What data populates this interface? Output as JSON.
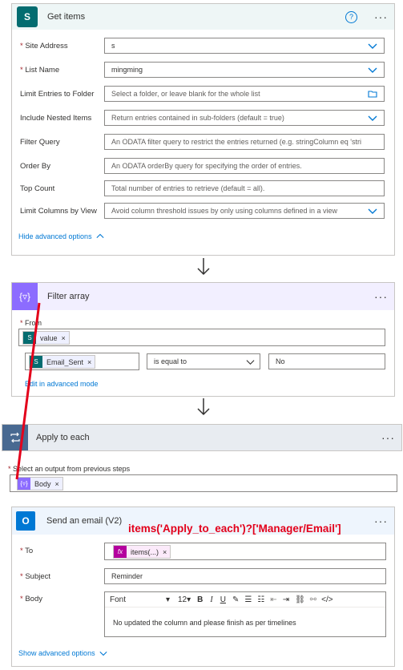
{
  "get_items": {
    "title": "Get items",
    "help_icon": "?",
    "site_address": {
      "label": "Site Address",
      "value": "s"
    },
    "list_name": {
      "label": "List Name",
      "value": "mingming"
    },
    "limit_folder": {
      "label": "Limit Entries to Folder",
      "placeholder": "Select a folder, or leave blank for the whole list"
    },
    "nested": {
      "label": "Include Nested Items",
      "placeholder": "Return entries contained in sub-folders (default = true)"
    },
    "filter_query": {
      "label": "Filter Query",
      "placeholder": "An ODATA filter query to restrict the entries returned (e.g. stringColumn eq 'stri"
    },
    "order_by": {
      "label": "Order By",
      "placeholder": "An ODATA orderBy query for specifying the order of entries."
    },
    "top_count": {
      "label": "Top Count",
      "placeholder": "Total number of entries to retrieve (default = all)."
    },
    "limit_columns": {
      "label": "Limit Columns by View",
      "placeholder": "Avoid column threshold issues by only using columns defined in a view"
    },
    "hide_advanced": "Hide advanced options"
  },
  "filter_array": {
    "title": "Filter array",
    "from_label": "From",
    "from_token": "value",
    "left_token": "Email_Sent",
    "operator": "is equal to",
    "right_value": "No",
    "edit_advanced": "Edit in advanced mode"
  },
  "apply_each": {
    "title": "Apply to each",
    "output_label": "Select an output from previous steps",
    "token": "Body"
  },
  "send_email": {
    "title": "Send an email (V2)",
    "annotation": "items('Apply_to_each')?['Manager/Email']",
    "to_label": "To",
    "to_token": "items(...)",
    "subject_label": "Subject",
    "subject_value": "Reminder",
    "body_label": "Body",
    "font": "Font",
    "font_size": "12",
    "body_text": "No updated the column and please finish as per timelines",
    "show_advanced": "Show advanced options"
  },
  "colors": {
    "sharepoint": "#036c70",
    "filter": "#8c6cff",
    "apply": "#486991",
    "outlook": "#0078d4",
    "fx": "#b4009e",
    "annotation": "#e3001b"
  }
}
